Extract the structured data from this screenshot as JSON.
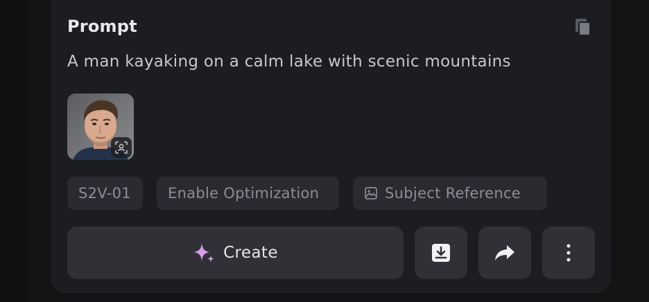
{
  "prompt_card": {
    "title": "Prompt",
    "prompt_text": "A man kayaking on a calm lake with scenic mountains",
    "copy_icon": "copy-icon",
    "reference_image": {
      "description_icon": "person-focus-icon"
    }
  },
  "chips": {
    "model": "S2V-01",
    "optimization": "Enable Optimization",
    "subject_reference": "Subject Reference",
    "subject_reference_icon": "image-icon"
  },
  "actions": {
    "create_label": "Create",
    "create_icon": "sparkle-icon",
    "download_icon": "download-icon",
    "share_icon": "share-icon",
    "more_icon": "more-vertical-icon"
  },
  "colors": {
    "background": "#131416",
    "card": "#1c1d21",
    "chip": "#2a2b30",
    "button": "#2f3137",
    "sparkle": "#d99be8"
  }
}
